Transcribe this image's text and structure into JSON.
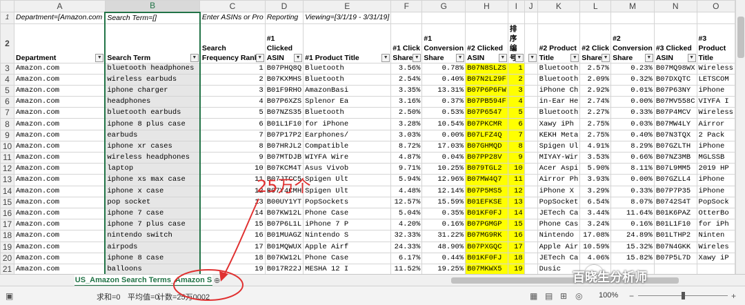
{
  "columns": [
    "A",
    "B",
    "C",
    "D",
    "E",
    "F",
    "G",
    "H",
    "I",
    "J",
    "K",
    "L",
    "M",
    "N",
    "O"
  ],
  "row1": {
    "A": "Department=[Amazon.com",
    "B": "Search Term=[]",
    "C": "Enter ASINs or Pro",
    "D": "Reporting",
    "E": "Viewing=[3/1/19 - 3/31/19]"
  },
  "headers": {
    "A": "Department",
    "B": "Search Term",
    "C": "Search Frequency Rank",
    "D": "#1 Clicked ASIN",
    "E": "#1 Product Title",
    "F": "#1 Click Share",
    "G": "#1 Conversion Share",
    "H": "#2 Clicked ASIN",
    "I": "排序编号",
    "J": "",
    "K": "#2 Product Title",
    "L": "#2 Click Share",
    "M": "#2 Conversion Share",
    "N": "#3 Clicked ASIN",
    "O": "#3 Product Title"
  },
  "rows": [
    {
      "n": "3",
      "a": "Amazon.com",
      "b": "bluetooth headphones",
      "c": "1",
      "d": "B07PHQ8Q",
      "e": "Bluetooth",
      "f": "3.56%",
      "g": "0.78%",
      "h": "B07N8SLZS",
      "i": "1",
      "k": "Bluetooth",
      "l": "2.57%",
      "m": "0.23%",
      "nn": "B07MQ98WX",
      "o": "Wireless"
    },
    {
      "n": "4",
      "a": "Amazon.com",
      "b": "wireless earbuds",
      "c": "2",
      "d": "B07KXMHS",
      "e": "Bluetooth",
      "f": "2.54%",
      "g": "0.40%",
      "h": "B07N2L29F",
      "i": "2",
      "k": "Bluetooth",
      "l": "2.09%",
      "m": "0.32%",
      "nn": "B07DXQTC",
      "o": "LETSCOM"
    },
    {
      "n": "5",
      "a": "Amazon.com",
      "b": "iphone charger",
      "c": "3",
      "d": "B01F9RHO",
      "e": "AmazonBasi",
      "f": "3.35%",
      "g": "13.31%",
      "h": "B07P6P6FW",
      "i": "3",
      "k": "iPhone Ch",
      "l": "2.92%",
      "m": "0.01%",
      "nn": "B07P63NY",
      "o": "iPhone"
    },
    {
      "n": "6",
      "a": "Amazon.com",
      "b": "headphones",
      "c": "4",
      "d": "B07P6XZS",
      "e": "Splenor Ea",
      "f": "3.16%",
      "g": "0.37%",
      "h": "B07PB594F",
      "i": "4",
      "k": "in-Ear He",
      "l": "2.74%",
      "m": "0.00%",
      "nn": "B07MV558C",
      "o": "VIYFA I"
    },
    {
      "n": "7",
      "a": "Amazon.com",
      "b": "bluetooth earbuds",
      "c": "5",
      "d": "B07NZS35",
      "e": "Bluetooth",
      "f": "2.50%",
      "g": "0.53%",
      "h": "B07P6547",
      "i": "5",
      "k": "Bluetooth",
      "l": "2.27%",
      "m": "0.33%",
      "nn": "B07P4MCV",
      "o": "Wireless"
    },
    {
      "n": "8",
      "a": "Amazon.com",
      "b": "iphone 8 plus case",
      "c": "6",
      "d": "B01L1F10",
      "e": "for iPhone",
      "f": "3.28%",
      "g": "10.54%",
      "h": "B07PKCMR",
      "i": "6",
      "k": "Xawy iPh",
      "l": "2.75%",
      "m": "0.03%",
      "nn": "B07MW4LY",
      "o": "Airror"
    },
    {
      "n": "9",
      "a": "Amazon.com",
      "b": "earbuds",
      "c": "7",
      "d": "B07P17P2",
      "e": "Earphones/",
      "f": "3.03%",
      "g": "0.00%",
      "h": "B07LFZ4Q",
      "i": "7",
      "k": "KEKH Meta",
      "l": "2.75%",
      "m": "0.40%",
      "nn": "B07N3TQX",
      "o": "2 Pack"
    },
    {
      "n": "10",
      "a": "Amazon.com",
      "b": "iphone xr cases",
      "c": "8",
      "d": "B07HRJL2",
      "e": "Compatible",
      "f": "8.72%",
      "g": "17.03%",
      "h": "B07GHMQD",
      "i": "8",
      "k": "Spigen Ul",
      "l": "4.91%",
      "m": "8.29%",
      "nn": "B07GZLTH",
      "o": "iPhone"
    },
    {
      "n": "11",
      "a": "Amazon.com",
      "b": "wireless headphones",
      "c": "9",
      "d": "B07MTDJB",
      "e": "WIYFA Wire",
      "f": "4.87%",
      "g": "0.04%",
      "h": "B07PP28V",
      "i": "9",
      "k": "MIYAY-Wir",
      "l": "3.53%",
      "m": "0.66%",
      "nn": "B07NZ3MB",
      "o": "MGLSSB"
    },
    {
      "n": "12",
      "a": "Amazon.com",
      "b": "laptop",
      "c": "10",
      "d": "B07KCM4T",
      "e": "Asus Vivob",
      "f": "9.71%",
      "g": "10.25%",
      "h": "B079TGL2",
      "i": "10",
      "k": "Acer Aspi",
      "l": "5.90%",
      "m": "8.11%",
      "nn": "B07L9MM5",
      "o": "2019 HP"
    },
    {
      "n": "13",
      "a": "Amazon.com",
      "b": "iphone xs max case",
      "c": "11",
      "d": "B07JTCC5",
      "e": "Spigen Ult",
      "f": "5.94%",
      "g": "12.96%",
      "h": "B07MW4Q7",
      "i": "11",
      "k": "Airror Ph",
      "l": "3.93%",
      "m": "0.00%",
      "nn": "B07GZLL4",
      "o": "iPhone"
    },
    {
      "n": "14",
      "a": "Amazon.com",
      "b": "iphone x case",
      "c": "12",
      "d": "B07Y4CMH",
      "e": "Spigen Ult",
      "f": "4.48%",
      "g": "12.14%",
      "h": "B07P5MS5",
      "i": "12",
      "k": "iPhone X",
      "l": "3.29%",
      "m": "0.33%",
      "nn": "B07P7P35",
      "o": "iPhone"
    },
    {
      "n": "15",
      "a": "Amazon.com",
      "b": "pop socket",
      "c": "13",
      "d": "B00UY1YT",
      "e": "PopSockets",
      "f": "12.57%",
      "g": "15.59%",
      "h": "B01EFKSE",
      "i": "13",
      "k": "PopSocket",
      "l": "6.54%",
      "m": "8.07%",
      "nn": "B0742S4T",
      "o": "PopSock"
    },
    {
      "n": "16",
      "a": "Amazon.com",
      "b": "iphone 7 case",
      "c": "14",
      "d": "B07KW12L",
      "e": "Phone Case",
      "f": "5.04%",
      "g": "0.35%",
      "h": "B01KF0FJ",
      "i": "14",
      "k": "JETech Ca",
      "l": "3.44%",
      "m": "11.64%",
      "nn": "B01K6PAZ",
      "o": "OtterBo"
    },
    {
      "n": "17",
      "a": "Amazon.com",
      "b": "iphone 7 plus case",
      "c": "15",
      "d": "B07P6L1L",
      "e": "iPhone 7 P",
      "f": "4.20%",
      "g": "0.16%",
      "h": "B07PGMGP",
      "i": "15",
      "k": "Phone Cas",
      "l": "3.24%",
      "m": "0.16%",
      "nn": "B01L1F10",
      "o": "for iPh"
    },
    {
      "n": "18",
      "a": "Amazon.com",
      "b": "nintendo switch",
      "c": "16",
      "d": "B01MUAGZ",
      "e": "Nintendo S",
      "f": "32.33%",
      "g": "31.22%",
      "h": "B07MG9RK",
      "i": "16",
      "k": "Nintendo",
      "l": "17.08%",
      "m": "24.89%",
      "nn": "B01LTHP2",
      "o": "Ninten"
    },
    {
      "n": "19",
      "a": "Amazon.com",
      "b": "airpods",
      "c": "17",
      "d": "B01MQWUX",
      "e": "Apple Airf",
      "f": "24.33%",
      "g": "48.90%",
      "h": "B07PXGQC",
      "i": "17",
      "k": "Apple Air",
      "l": "10.59%",
      "m": "15.32%",
      "nn": "B07N4GKK",
      "o": "Wireles"
    },
    {
      "n": "20",
      "a": "Amazon.com",
      "b": "iphone 8 case",
      "c": "18",
      "d": "B07KW12L",
      "e": "Phone Case",
      "f": "6.17%",
      "g": "0.44%",
      "h": "B01KF0FJ",
      "i": "18",
      "k": "JETech Ca",
      "l": "4.06%",
      "m": "15.82%",
      "nn": "B07P5L7D",
      "o": "Xawy iP"
    },
    {
      "n": "21",
      "a": "Amazon.com",
      "b": "balloons",
      "c": "19",
      "d": "B017R22J",
      "e": "MESHA 12 I",
      "f": "11.52%",
      "g": "19.25%",
      "h": "B07MKWX5",
      "i": "19",
      "k": "Dusic",
      "l": "",
      "m": "",
      "nn": "",
      "o": ""
    }
  ],
  "sheet_tab": "US_Amazon Search Terms_Amazon S",
  "status": {
    "sum": "求和=0",
    "avg": "平均值=0",
    "count": "计数=25万0002",
    "zoom": "100%"
  },
  "annotation": "25万个",
  "watermark": "百晓生分析师",
  "colors": {
    "highlight": "#ffff00",
    "accent": "#217346",
    "annotation": "#e03030"
  }
}
